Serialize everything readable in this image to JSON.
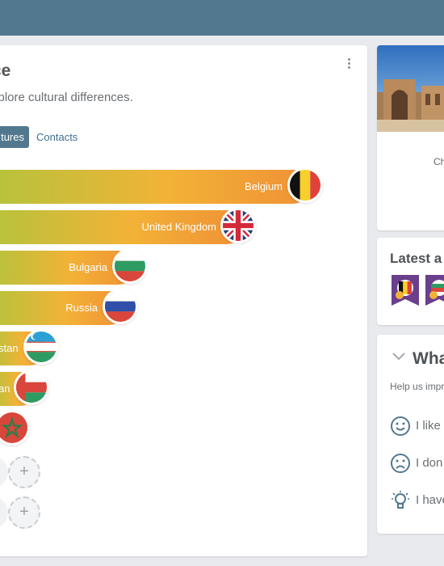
{
  "header": {},
  "main": {
    "title": "ce",
    "subtitle": "xplore cultural differences.",
    "tabs": [
      {
        "label": "tures",
        "active": true
      },
      {
        "label": "Contacts",
        "active": false
      }
    ],
    "countries": [
      {
        "label": "Belgium",
        "flag": "belgium-flag"
      },
      {
        "label": "United Kingdom",
        "flag": "uk-flag"
      },
      {
        "label": "Bulgaria",
        "flag": "bulgaria-flag"
      },
      {
        "label": "Russia",
        "flag": "russia-flag"
      },
      {
        "label": "stan",
        "flag": "uzbekistan-flag"
      },
      {
        "label": "an",
        "flag": "oman-flag"
      },
      {
        "label": "",
        "flag": "morocco-flag"
      }
    ],
    "add_slots": [
      "+",
      "+"
    ]
  },
  "photo_card": {
    "caption": "Ch"
  },
  "achievements": {
    "title": "Latest a"
  },
  "feedback": {
    "title": "Wha",
    "subtitle": "Help us impr",
    "options": [
      {
        "icon": "smile-icon",
        "text": "I like"
      },
      {
        "icon": "frown-icon",
        "text": "I don"
      },
      {
        "icon": "lightbulb-icon",
        "text": "I have"
      }
    ]
  },
  "colors": {
    "header": "#527890",
    "accent": "#527890",
    "bar_start": "#b6c33c",
    "bar_mid": "#f2b237",
    "bar_end": "#f09136"
  }
}
